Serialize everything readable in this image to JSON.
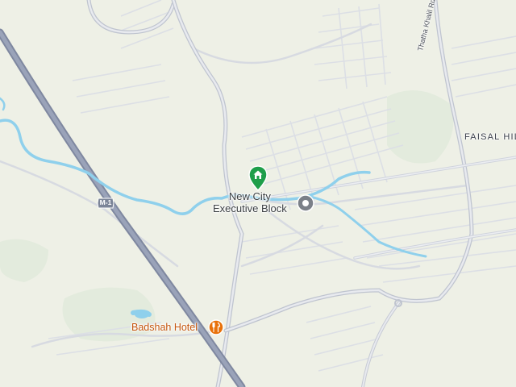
{
  "map": {
    "area_label": "FAISAL HILLS",
    "road_label": "Thatha Khalil Rd",
    "highway_shield": "M-1",
    "poi": {
      "name_line1": "New City",
      "name_line2": "Executive Block"
    },
    "restaurant": {
      "name": "Badshah Hotel"
    },
    "colors": {
      "background": "#eef0e6",
      "river": "#8fd0ec",
      "motorway": "#8c95ad",
      "major_road": "#c1c6d2",
      "minor_road": "#dde0e6",
      "home_pin": "#1e9e4a",
      "poi_pin": "#7b8088",
      "restaurant_pin": "#e8710a"
    },
    "icons": {
      "home_pin": "home-pin-icon",
      "poi_pin": "place-pin-icon",
      "restaurant_pin": "restaurant-icon"
    }
  }
}
